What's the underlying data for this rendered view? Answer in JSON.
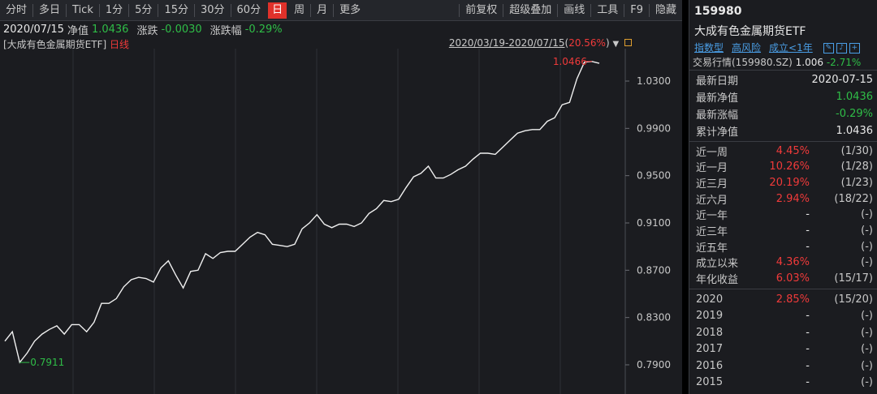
{
  "toolbar": {
    "left": [
      "分时",
      "多日",
      "Tick",
      "1分",
      "5分",
      "15分",
      "30分",
      "60分",
      "日",
      "周",
      "月",
      "更多"
    ],
    "active": "日",
    "right": [
      "前复权",
      "超级叠加",
      "画线",
      "工具",
      "F9",
      "隐藏"
    ]
  },
  "info": {
    "date": "2020/07/15",
    "nav_label": "净值",
    "nav_value": "1.0436",
    "chg_label": "涨跌",
    "chg_value": "-0.0030",
    "pct_label": "涨跌幅",
    "pct_value": "-0.29%"
  },
  "chart_header": {
    "name": "[大成有色金属期货ETF]",
    "type": "日线",
    "range": "2020/03/19-2020/07/15",
    "range_pct": "20.56%"
  },
  "chart_data": {
    "type": "line",
    "yticks": [
      "1.0300",
      "0.9900",
      "0.9500",
      "0.9100",
      "0.8700",
      "0.8300",
      "0.7900"
    ],
    "ylim": [
      0.775,
      1.075
    ],
    "max_label": "1.0466",
    "min_label": "0.7911",
    "values": [
      0.81,
      0.818,
      0.792,
      0.8,
      0.81,
      0.816,
      0.82,
      0.823,
      0.816,
      0.824,
      0.824,
      0.818,
      0.826,
      0.842,
      0.842,
      0.846,
      0.856,
      0.862,
      0.864,
      0.863,
      0.86,
      0.872,
      0.878,
      0.866,
      0.855,
      0.869,
      0.87,
      0.884,
      0.88,
      0.885,
      0.886,
      0.886,
      0.892,
      0.898,
      0.902,
      0.9,
      0.892,
      0.891,
      0.89,
      0.892,
      0.905,
      0.91,
      0.917,
      0.909,
      0.906,
      0.909,
      0.909,
      0.907,
      0.91,
      0.918,
      0.922,
      0.929,
      0.928,
      0.93,
      0.94,
      0.949,
      0.952,
      0.958,
      0.948,
      0.948,
      0.951,
      0.955,
      0.958,
      0.964,
      0.969,
      0.969,
      0.968,
      0.974,
      0.98,
      0.986,
      0.988,
      0.989,
      0.989,
      0.996,
      0.999,
      1.01,
      1.012,
      1.032,
      1.046,
      1.0466,
      1.045
    ]
  },
  "right": {
    "code": "159980",
    "name": "大成有色金属期货ETF",
    "tags": [
      "指数型",
      "高风险",
      "成立<1年"
    ],
    "icons": [
      "edit-icon",
      "bell-icon",
      "plus-icon"
    ],
    "quote_label": "交易行情(159980.SZ)",
    "quote_price": "1.006",
    "quote_pct": "-2.71%",
    "basic": [
      {
        "label": "最新日期",
        "value": "2020-07-15",
        "color": "white"
      },
      {
        "label": "最新净值",
        "value": "1.0436",
        "color": "green"
      },
      {
        "label": "最新涨幅",
        "value": "-0.29%",
        "color": "green"
      },
      {
        "label": "累计净值",
        "value": "1.0436",
        "color": "white"
      }
    ],
    "perf": [
      {
        "label": "近一周",
        "value": "4.45%",
        "rank": "(1/30)",
        "color": "red"
      },
      {
        "label": "近一月",
        "value": "10.26%",
        "rank": "(1/28)",
        "color": "red"
      },
      {
        "label": "近三月",
        "value": "20.19%",
        "rank": "(1/23)",
        "color": "red"
      },
      {
        "label": "近六月",
        "value": "2.94%",
        "rank": "(18/22)",
        "color": "red"
      },
      {
        "label": "近一年",
        "value": "-",
        "rank": "(-)",
        "color": "white"
      },
      {
        "label": "近三年",
        "value": "-",
        "rank": "(-)",
        "color": "white"
      },
      {
        "label": "近五年",
        "value": "-",
        "rank": "(-)",
        "color": "white"
      },
      {
        "label": "成立以来",
        "value": "4.36%",
        "rank": "(-)",
        "color": "red"
      },
      {
        "label": "年化收益",
        "value": "6.03%",
        "rank": "(15/17)",
        "color": "red"
      }
    ],
    "years": [
      {
        "label": "2020",
        "value": "2.85%",
        "rank": "(15/20)",
        "color": "red"
      },
      {
        "label": "2019",
        "value": "-",
        "rank": "(-)",
        "color": "white"
      },
      {
        "label": "2018",
        "value": "-",
        "rank": "(-)",
        "color": "white"
      },
      {
        "label": "2017",
        "value": "-",
        "rank": "(-)",
        "color": "white"
      },
      {
        "label": "2016",
        "value": "-",
        "rank": "(-)",
        "color": "white"
      },
      {
        "label": "2015",
        "value": "-",
        "rank": "(-)",
        "color": "white"
      }
    ]
  }
}
